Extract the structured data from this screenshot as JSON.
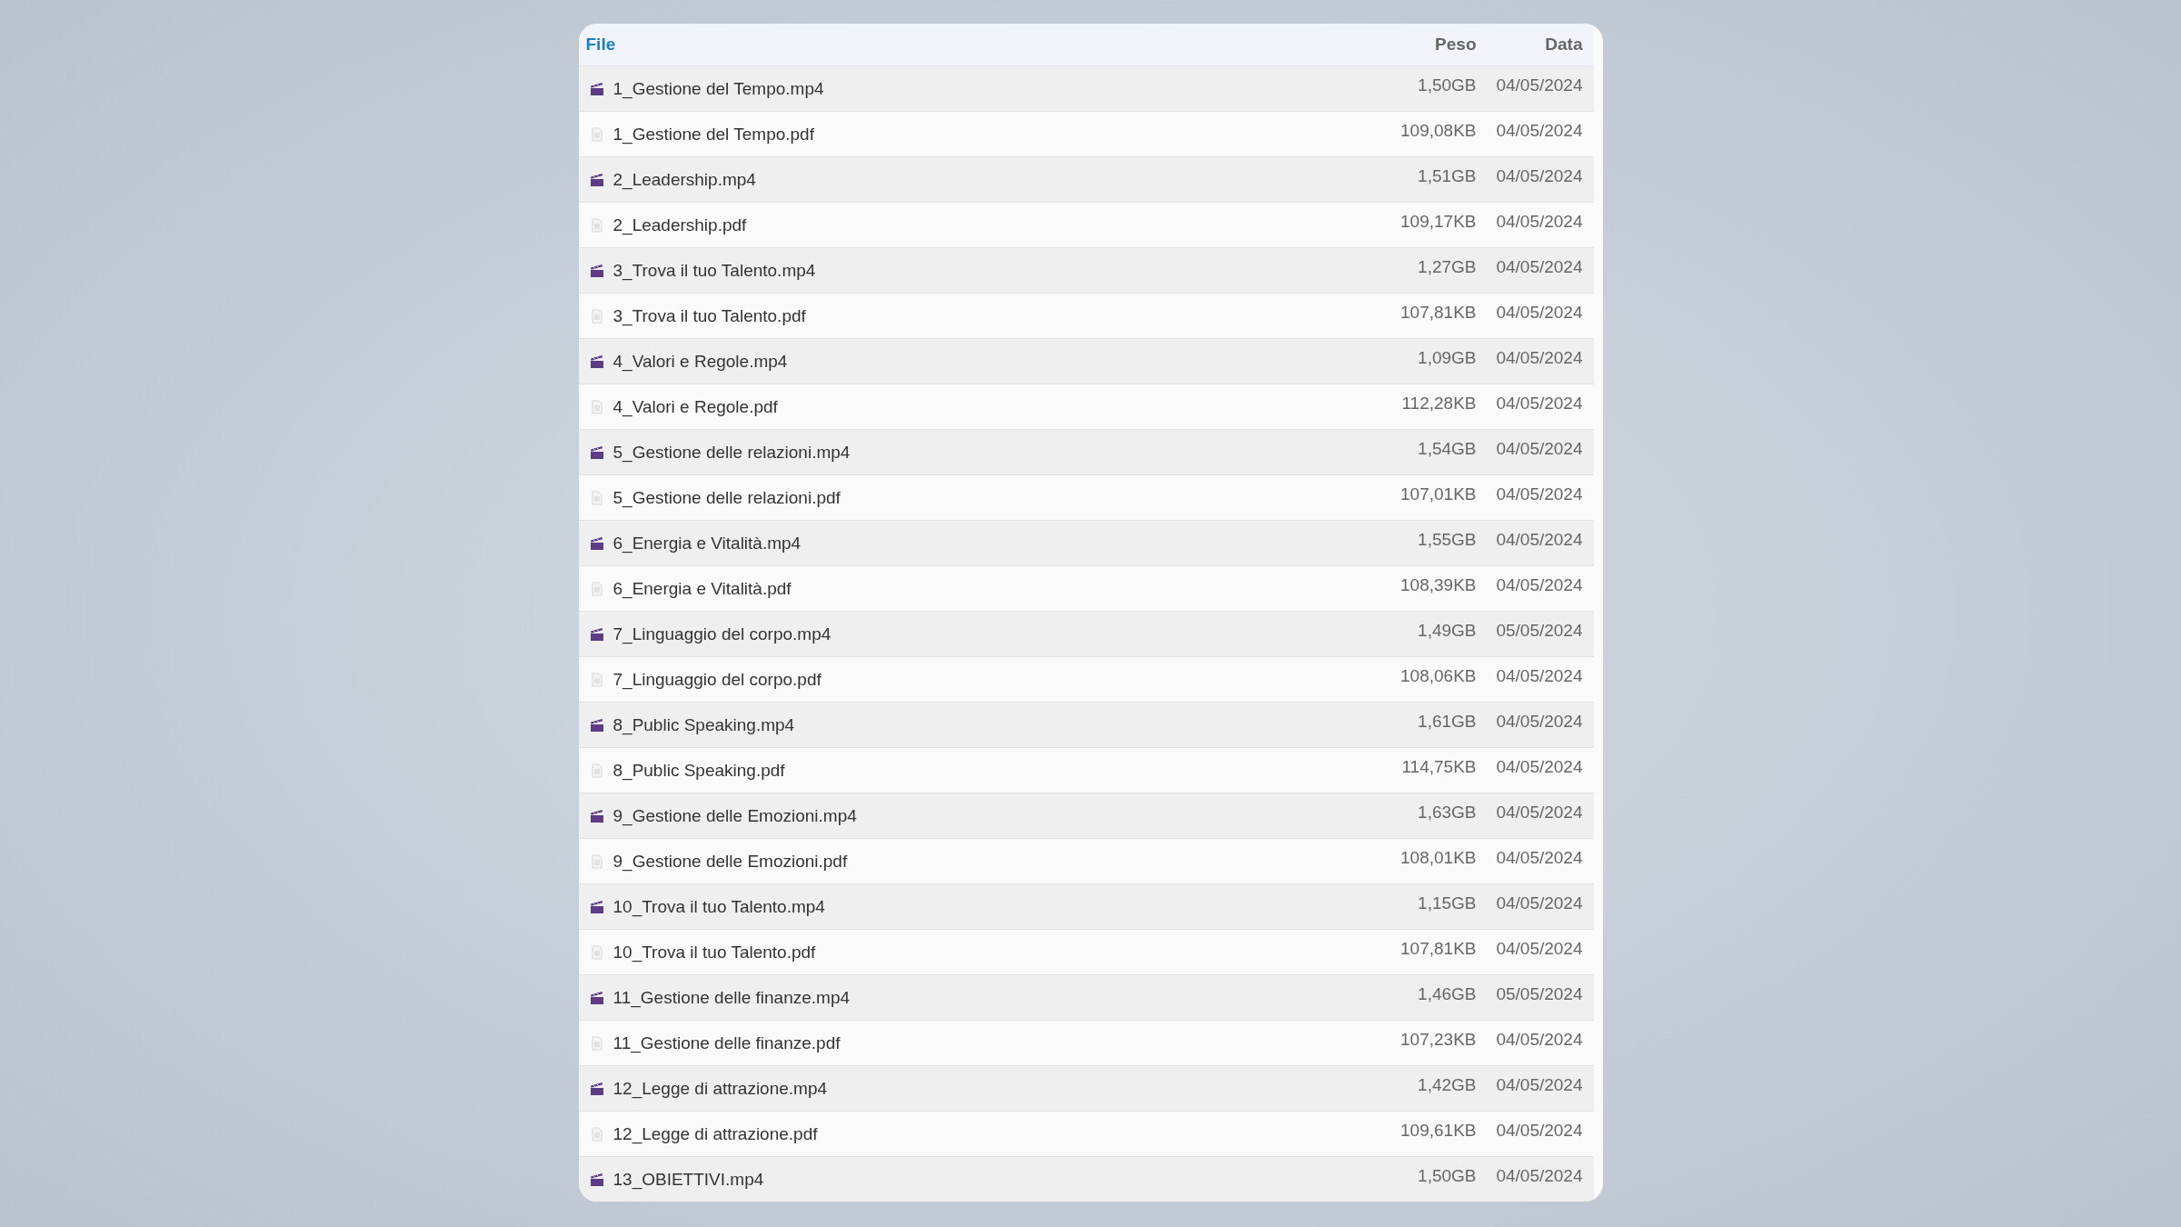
{
  "table": {
    "columns": [
      "File",
      "Peso",
      "Data"
    ],
    "rows": [
      {
        "kind": "video",
        "name": "1_Gestione del Tempo.mp4",
        "size": "1,50GB",
        "date": "04/05/2024"
      },
      {
        "kind": "document",
        "name": "1_Gestione del Tempo.pdf",
        "size": "109,08KB",
        "date": "04/05/2024"
      },
      {
        "kind": "video",
        "name": "2_Leadership.mp4",
        "size": "1,51GB",
        "date": "04/05/2024"
      },
      {
        "kind": "document",
        "name": "2_Leadership.pdf",
        "size": "109,17KB",
        "date": "04/05/2024"
      },
      {
        "kind": "video",
        "name": "3_Trova il tuo Talento.mp4",
        "size": "1,27GB",
        "date": "04/05/2024"
      },
      {
        "kind": "document",
        "name": "3_Trova il tuo Talento.pdf",
        "size": "107,81KB",
        "date": "04/05/2024"
      },
      {
        "kind": "video",
        "name": "4_Valori e Regole.mp4",
        "size": "1,09GB",
        "date": "04/05/2024"
      },
      {
        "kind": "document",
        "name": "4_Valori e Regole.pdf",
        "size": "112,28KB",
        "date": "04/05/2024"
      },
      {
        "kind": "video",
        "name": "5_Gestione delle relazioni.mp4",
        "size": "1,54GB",
        "date": "04/05/2024"
      },
      {
        "kind": "document",
        "name": "5_Gestione delle relazioni.pdf",
        "size": "107,01KB",
        "date": "04/05/2024"
      },
      {
        "kind": "video",
        "name": "6_Energia e Vitalità.mp4",
        "size": "1,55GB",
        "date": "04/05/2024"
      },
      {
        "kind": "document",
        "name": "6_Energia e Vitalità.pdf",
        "size": "108,39KB",
        "date": "04/05/2024"
      },
      {
        "kind": "video",
        "name": "7_Linguaggio del corpo.mp4",
        "size": "1,49GB",
        "date": "05/05/2024"
      },
      {
        "kind": "document",
        "name": "7_Linguaggio del corpo.pdf",
        "size": "108,06KB",
        "date": "04/05/2024"
      },
      {
        "kind": "video",
        "name": "8_Public Speaking.mp4",
        "size": "1,61GB",
        "date": "04/05/2024"
      },
      {
        "kind": "document",
        "name": "8_Public Speaking.pdf",
        "size": "114,75KB",
        "date": "04/05/2024"
      },
      {
        "kind": "video",
        "name": "9_Gestione delle Emozioni.mp4",
        "size": "1,63GB",
        "date": "04/05/2024"
      },
      {
        "kind": "document",
        "name": "9_Gestione delle Emozioni.pdf",
        "size": "108,01KB",
        "date": "04/05/2024"
      },
      {
        "kind": "video",
        "name": "10_Trova il tuo Talento.mp4",
        "size": "1,15GB",
        "date": "04/05/2024"
      },
      {
        "kind": "document",
        "name": "10_Trova il tuo Talento.pdf",
        "size": "107,81KB",
        "date": "04/05/2024"
      },
      {
        "kind": "video",
        "name": "11_Gestione delle finanze.mp4",
        "size": "1,46GB",
        "date": "05/05/2024"
      },
      {
        "kind": "document",
        "name": "11_Gestione delle finanze.pdf",
        "size": "107,23KB",
        "date": "04/05/2024"
      },
      {
        "kind": "video",
        "name": "12_Legge di attrazione.mp4",
        "size": "1,42GB",
        "date": "04/05/2024"
      },
      {
        "kind": "document",
        "name": "12_Legge di attrazione.pdf",
        "size": "109,61KB",
        "date": "04/05/2024"
      },
      {
        "kind": "video",
        "name": "13_OBIETTIVI.mp4",
        "size": "1,50GB",
        "date": "04/05/2024"
      }
    ]
  }
}
